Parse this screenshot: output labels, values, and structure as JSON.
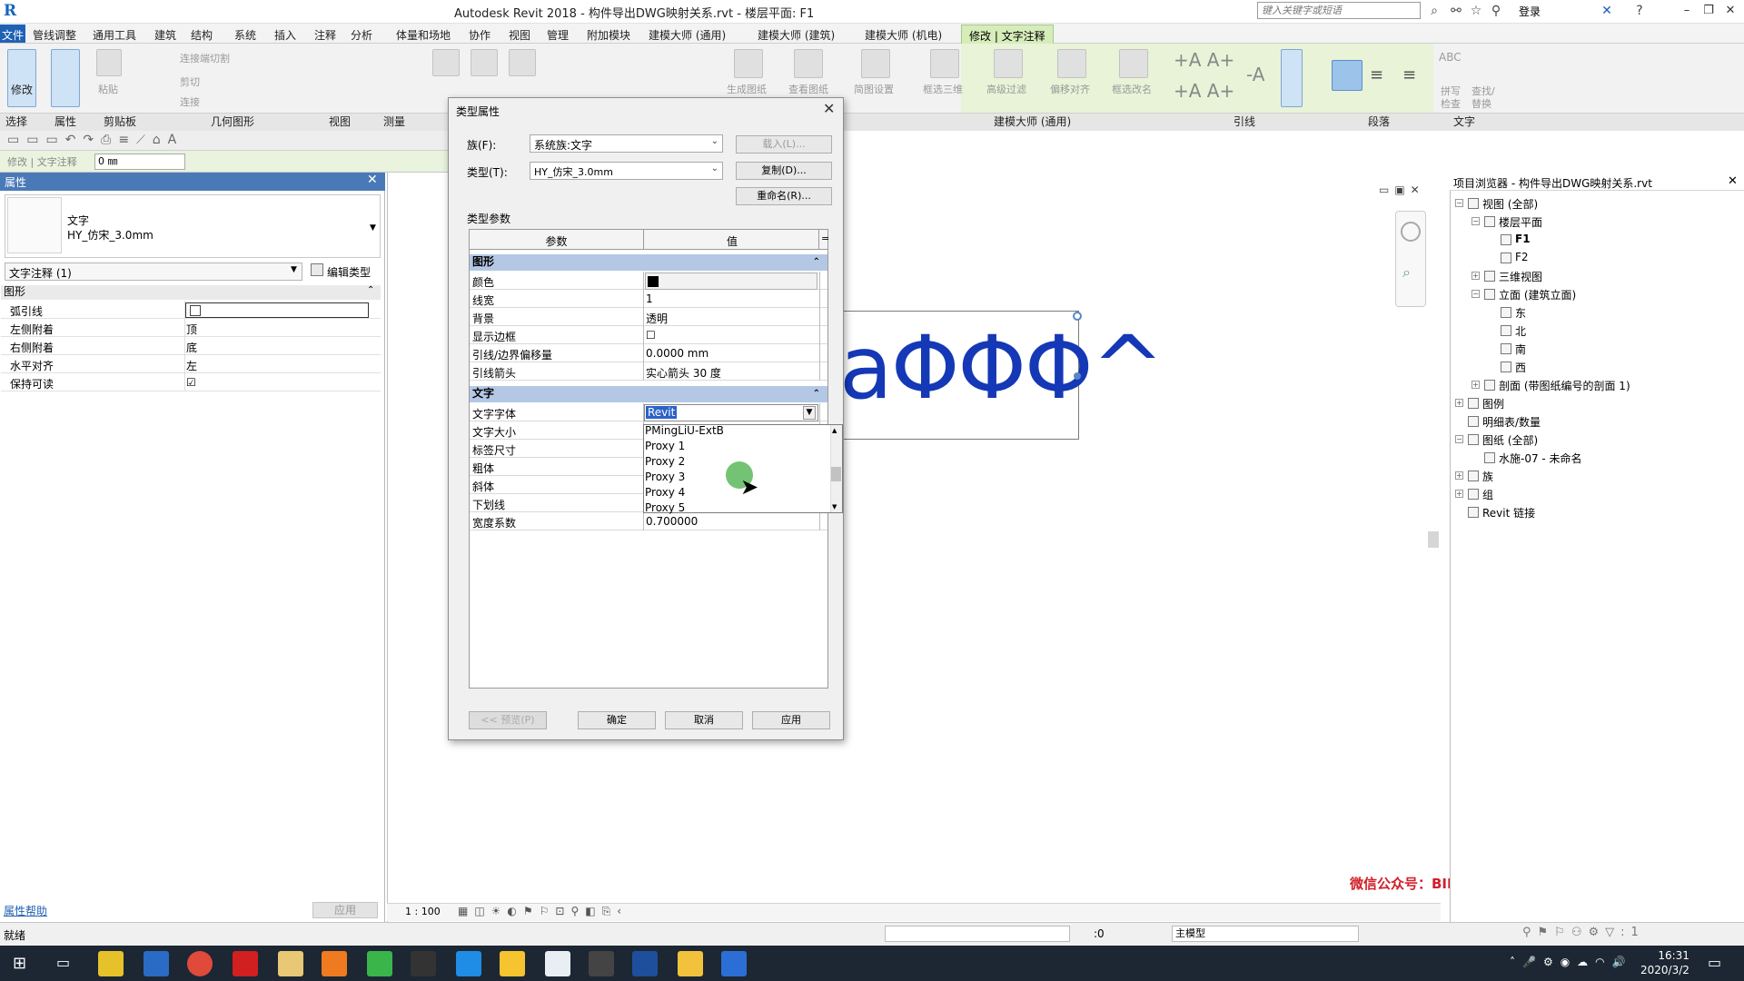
{
  "app": {
    "title": "Autodesk Revit 2018 -    构件导出DWG映射关系.rvt - 楼层平面: F1",
    "search_placeholder": "键入关键字或短语",
    "login": "登录"
  },
  "menu": {
    "file": "文件",
    "tabs": [
      "管线调整",
      "通用工具",
      "建筑",
      "结构",
      "系统",
      "插入",
      "注释",
      "分析",
      "体量和场地",
      "协作",
      "视图",
      "管理",
      "附加模块",
      "建模大师 (通用)",
      "建模大师 (建筑)",
      "建模大师 (机电)"
    ],
    "active_tab": "修改 | 文字注释"
  },
  "ribbon": {
    "modify_label": "修改",
    "paste_label": "粘贴",
    "cut_label": "连接端切割",
    "cut2_label": "剪切",
    "join_label": "连接",
    "gen_drawing": "生成图纸",
    "view_drawing": "查看图纸",
    "simple_setting": "简图设置",
    "frame_3d": "框选三维",
    "adv_filter": "高级过滤",
    "offset_align": "偏移对齐",
    "frame_rename": "框选改名",
    "spell_check": "拼写\n检查",
    "find_replace": "查找/\n替换",
    "panels": {
      "select": "选择",
      "properties": "属性",
      "clipboard": "剪贴板",
      "geometry": "几何图形",
      "view": "视图",
      "measure": "测量",
      "modeling_master": "建模大师 (通用)",
      "leader": "引线",
      "paragraph": "段落",
      "text": "文字"
    }
  },
  "options_bar": {
    "label": "修改 | 文字注释",
    "value": "0 ㎜"
  },
  "properties": {
    "header": "属性",
    "type_line1": "文字",
    "type_line2": "HY_仿宋_3.0mm",
    "filter": "文字注释 (1)",
    "edit_type": "编辑类型",
    "group": "图形",
    "rows": [
      {
        "key": "弧引线",
        "value": ""
      },
      {
        "key": "左侧附着",
        "value": "顶"
      },
      {
        "key": "右侧附着",
        "value": "底"
      },
      {
        "key": "水平对齐",
        "value": "左"
      },
      {
        "key": "保持可读",
        "value": "☑"
      }
    ],
    "help": "属性帮助",
    "apply": "应用"
  },
  "canvas": {
    "glyph_text": "aΦΦΦ^",
    "watermark": "微信公众号：BIM志（未经授权，谢绝转载）",
    "scale": "1 : 100"
  },
  "browser": {
    "header": "项目浏览器 - 构件导出DWG映射关系.rvt",
    "items": [
      {
        "label": "视图 (全部)",
        "level": 0,
        "exp": "−"
      },
      {
        "label": "楼层平面",
        "level": 1,
        "exp": "−"
      },
      {
        "label": "F1",
        "level": 2,
        "exp": "",
        "bold": true
      },
      {
        "label": "F2",
        "level": 2,
        "exp": ""
      },
      {
        "label": "三维视图",
        "level": 1,
        "exp": "+"
      },
      {
        "label": "立面 (建筑立面)",
        "level": 1,
        "exp": "−"
      },
      {
        "label": "东",
        "level": 2,
        "exp": ""
      },
      {
        "label": "北",
        "level": 2,
        "exp": ""
      },
      {
        "label": "南",
        "level": 2,
        "exp": ""
      },
      {
        "label": "西",
        "level": 2,
        "exp": ""
      },
      {
        "label": "剖面 (带图纸编号的剖面 1)",
        "level": 1,
        "exp": "+"
      },
      {
        "label": "图例",
        "level": 0,
        "exp": "+"
      },
      {
        "label": "明细表/数量",
        "level": 0,
        "exp": ""
      },
      {
        "label": "图纸 (全部)",
        "level": 0,
        "exp": "−"
      },
      {
        "label": "水施-07 - 未命名",
        "level": 1,
        "exp": ""
      },
      {
        "label": "族",
        "level": 0,
        "exp": "+"
      },
      {
        "label": "组",
        "level": 0,
        "exp": "+"
      },
      {
        "label": "Revit 链接",
        "level": 0,
        "exp": ""
      }
    ]
  },
  "dialog": {
    "title": "类型属性",
    "family_label": "族(F):",
    "family_value": "系统族:文字",
    "type_label": "类型(T):",
    "type_value": "HY_仿宋_3.0mm",
    "load_btn": "载入(L)...",
    "duplicate_btn": "复制(D)...",
    "rename_btn": "重命名(R)...",
    "type_params": "类型参数",
    "col_param": "参数",
    "col_value": "值",
    "group_graphics": "图形",
    "graphics_rows": [
      {
        "key": "颜色",
        "value": "■ 黑色"
      },
      {
        "key": "线宽",
        "value": "1"
      },
      {
        "key": "背景",
        "value": "透明"
      },
      {
        "key": "显示边框",
        "value": "☐"
      },
      {
        "key": "引线/边界偏移量",
        "value": "0.0000 mm"
      },
      {
        "key": "引线箭头",
        "value": "实心箭头 30 度"
      }
    ],
    "group_text": "文字",
    "text_rows": [
      {
        "key": "文字字体",
        "value": "Revit"
      },
      {
        "key": "文字大小",
        "value": ""
      },
      {
        "key": "标签尺寸",
        "value": ""
      },
      {
        "key": "粗体",
        "value": ""
      },
      {
        "key": "斜体",
        "value": ""
      },
      {
        "key": "下划线",
        "value": ""
      },
      {
        "key": "宽度系数",
        "value": "0.700000"
      }
    ],
    "font_options": [
      "PMingLiU-ExtB",
      "Proxy 1",
      "Proxy 2",
      "Proxy 3",
      "Proxy 4",
      "Proxy 5"
    ],
    "preview_btn": "<< 预览(P)",
    "ok_btn": "确定",
    "cancel_btn": "取消",
    "apply_btn": "应用"
  },
  "status": {
    "ready": "就绪",
    "zero": ":0",
    "model": "主模型"
  },
  "clock": {
    "time": "16:31",
    "date": "2020/3/2"
  }
}
